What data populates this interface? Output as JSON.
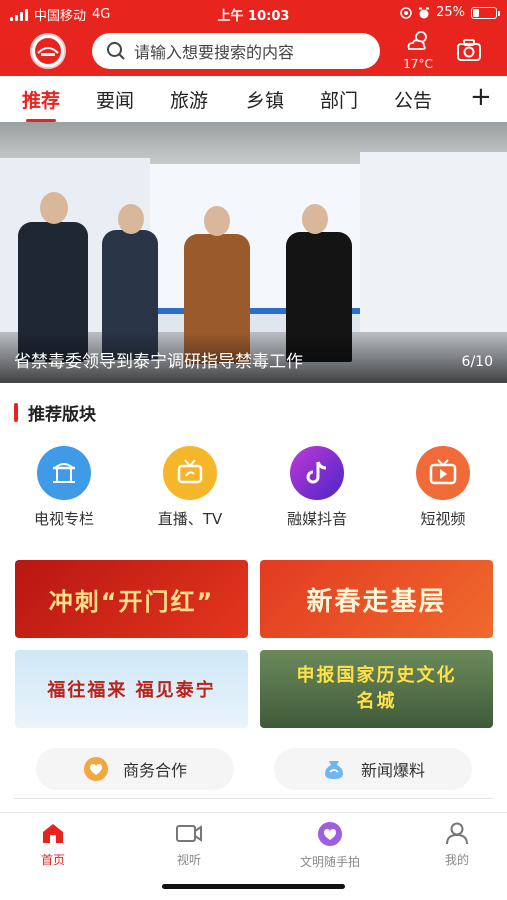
{
  "status_bar": {
    "carrier": "中国移动",
    "network": "4G",
    "time": "上午 10:03",
    "battery": "25%",
    "battery_level": 0.25
  },
  "header": {
    "search_placeholder": "请输入想要搜索的内容",
    "weather_temp": "17°C",
    "weather_icon": "cloud-sun-icon",
    "camera_icon": "camera-icon"
  },
  "tabs": [
    {
      "label": "推荐",
      "active": true
    },
    {
      "label": "要闻"
    },
    {
      "label": "旅游"
    },
    {
      "label": "乡镇"
    },
    {
      "label": "部门"
    },
    {
      "label": "公告"
    }
  ],
  "tabs_more": "+",
  "banner": {
    "caption": "省禁毒委领导到泰宁调研指导禁毒工作",
    "counter": "6/10"
  },
  "recommend": {
    "title": "推荐版块",
    "items": [
      {
        "label": "电视专栏",
        "icon": "tv-column-icon",
        "color": "#3f9be8"
      },
      {
        "label": "直播、TV",
        "icon": "live-tv-icon",
        "color": "#f5b62a"
      },
      {
        "label": "融媒抖音",
        "icon": "tiktok-icon",
        "color": "#7a2bd6"
      },
      {
        "label": "短视频",
        "icon": "short-video-icon",
        "color": "#f06a3a"
      }
    ]
  },
  "promos": [
    {
      "text": "冲刺“开门红”"
    },
    {
      "text": "新春走基层"
    },
    {
      "text": "福往福来 福见泰宁"
    },
    {
      "text": "申报国家历史文化名城"
    }
  ],
  "actions": [
    {
      "label": "商务合作",
      "icon": "heart-handshake-icon"
    },
    {
      "label": "新闻爆料",
      "icon": "tip-bag-icon"
    }
  ],
  "bottom_nav": [
    {
      "label": "首页",
      "icon": "home-icon",
      "active": true
    },
    {
      "label": "视听",
      "icon": "video-camera-icon"
    },
    {
      "label": "文明随手拍",
      "icon": "snapshot-icon"
    },
    {
      "label": "我的",
      "icon": "user-icon"
    }
  ]
}
